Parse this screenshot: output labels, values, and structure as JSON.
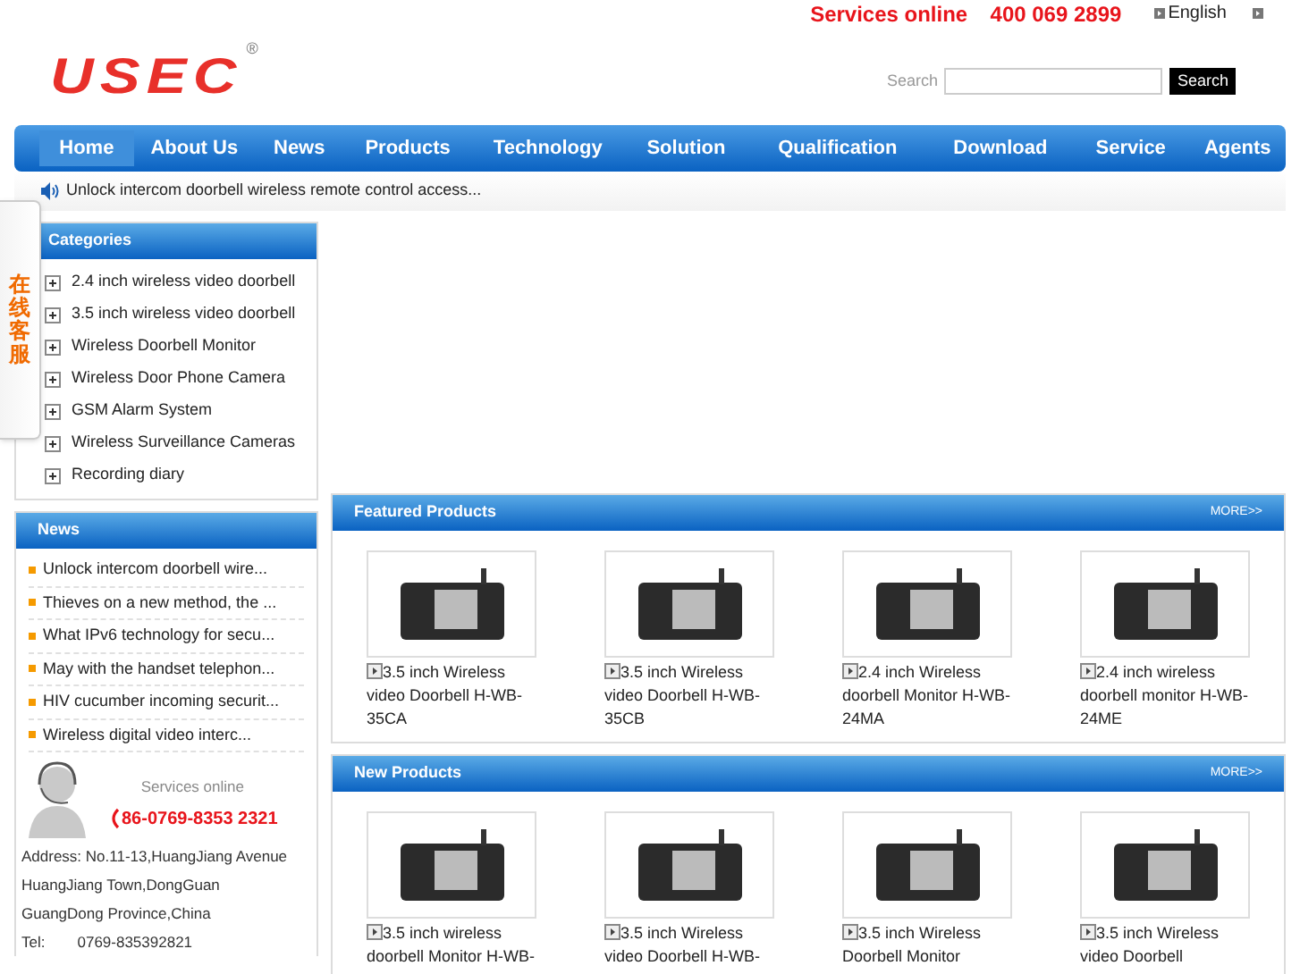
{
  "top_bar": {
    "services_label": "Services online",
    "phone": "400 069 2899",
    "language": "English"
  },
  "logo": {
    "text": "USEC",
    "mark": "®"
  },
  "search": {
    "label": "Search",
    "button": "Search"
  },
  "nav": [
    {
      "label": "Home",
      "selected": true
    },
    {
      "label": "About Us",
      "selected": false
    },
    {
      "label": "News",
      "selected": false
    },
    {
      "label": "Products",
      "selected": false
    },
    {
      "label": "Technology",
      "selected": false
    },
    {
      "label": "Solution",
      "selected": false
    },
    {
      "label": "Qualification",
      "selected": false
    },
    {
      "label": "Download",
      "selected": false
    },
    {
      "label": "Service",
      "selected": false
    },
    {
      "label": "Agents",
      "selected": false
    }
  ],
  "ticker": "Unlock intercom doorbell wireless remote control access...",
  "float_tab": "在线客服",
  "categories": {
    "title": "Categories",
    "items": [
      "2.4 inch wireless video doorbell",
      "3.5 inch wireless video doorbell",
      "Wireless Doorbell Monitor",
      "Wireless Door Phone Camera",
      "GSM Alarm System",
      "Wireless Surveillance Cameras",
      "Recording diary"
    ]
  },
  "news": {
    "title": "News",
    "items": [
      "Unlock intercom doorbell wire...",
      "Thieves on a new method, the ...",
      "What IPv6 technology for secu...",
      "May with the handset telephon...",
      "HIV cucumber incoming securit...",
      "Wireless digital video interc..."
    ]
  },
  "contact": {
    "title": "Services online",
    "hotline": "86-0769-8353 2321",
    "address_lines": [
      "Address: No.11-13,HuangJiang Avenue",
      "HuangJiang Town,DongGuan",
      "GuangDong Province,China"
    ],
    "tel_label": "Tel:",
    "tel": "0769-835392821"
  },
  "sections": [
    {
      "title": "Featured Products",
      "more": "MORE>>",
      "products": [
        "3.5 inch Wireless video Doorbell H-WB-35CA",
        "3.5 inch Wireless video Doorbell H-WB-35CB",
        "2.4 inch Wireless doorbell Monitor H-WB-24MA",
        "2.4 inch wireless doorbell monitor H-WB-24ME"
      ]
    },
    {
      "title": "New Products",
      "more": "MORE>>",
      "products": [
        "3.5 inch wireless doorbell Monitor H-WB-",
        "3.5 inch Wireless video Doorbell H-WB-",
        "3.5 inch Wireless Doorbell Monitor",
        "3.5 inch Wireless video Doorbell"
      ]
    }
  ]
}
